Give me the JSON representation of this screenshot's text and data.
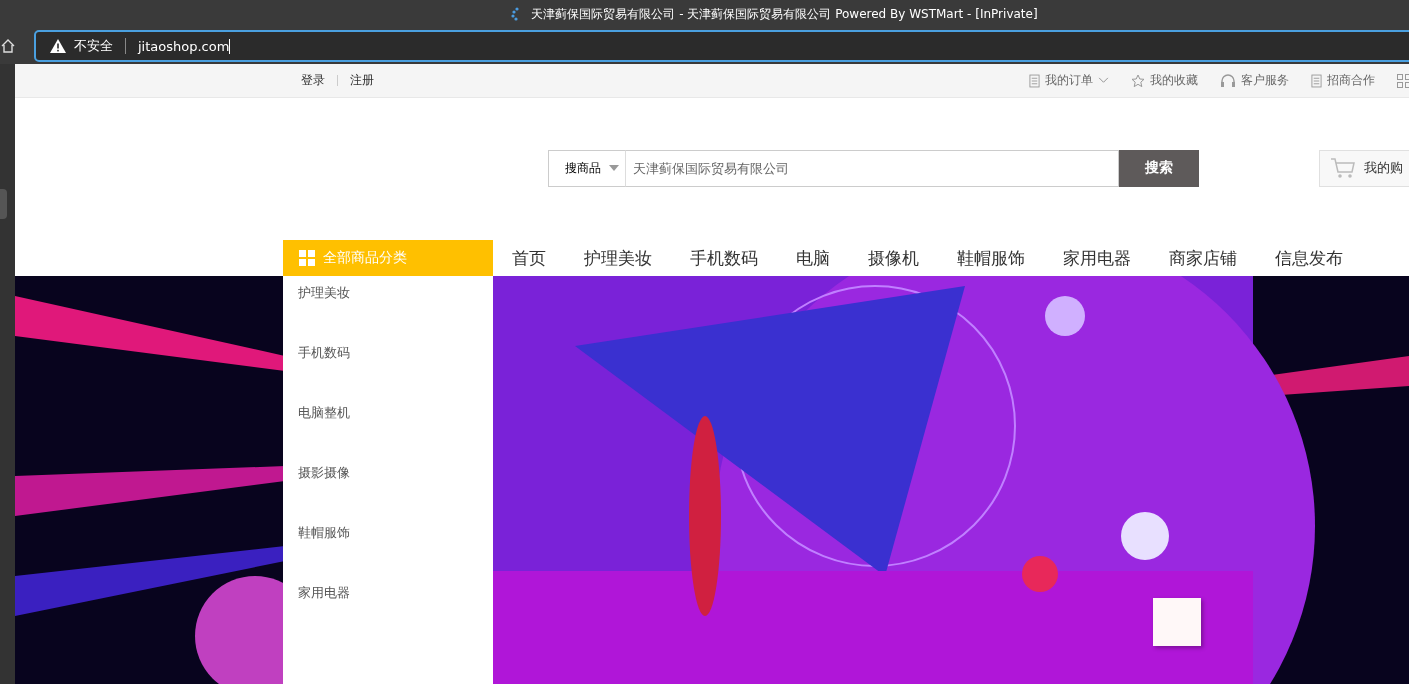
{
  "browser": {
    "title": "天津蓟保国际贸易有限公司 - 天津蓟保国际贸易有限公司 Powered By WSTMart - [InPrivate]",
    "security": "不安全",
    "url": "jitaoshop.com"
  },
  "topbar": {
    "left_links": [
      "登录",
      "注册"
    ],
    "right_links": [
      {
        "label": "我的订单",
        "kind": "document",
        "dropdown": true
      },
      {
        "label": "我的收藏",
        "kind": "star",
        "dropdown": false
      },
      {
        "label": "客户服务",
        "kind": "headset",
        "dropdown": false
      },
      {
        "label": "招商合作",
        "kind": "document",
        "dropdown": false
      }
    ]
  },
  "search": {
    "scope": "搜商品",
    "placeholder": "天津蓟保国际贸易有限公司",
    "button": "搜索"
  },
  "cart": {
    "label": "我的购"
  },
  "category_button": "全部商品分类",
  "nav": [
    "首页",
    "护理美妆",
    "手机数码",
    "电脑",
    "摄像机",
    "鞋帽服饰",
    "家用电器",
    "商家店铺",
    "信息发布"
  ],
  "categories": [
    "护理美妆",
    "手机数码",
    "电脑整机",
    "摄影摄像",
    "鞋帽服饰",
    "家用电器"
  ]
}
